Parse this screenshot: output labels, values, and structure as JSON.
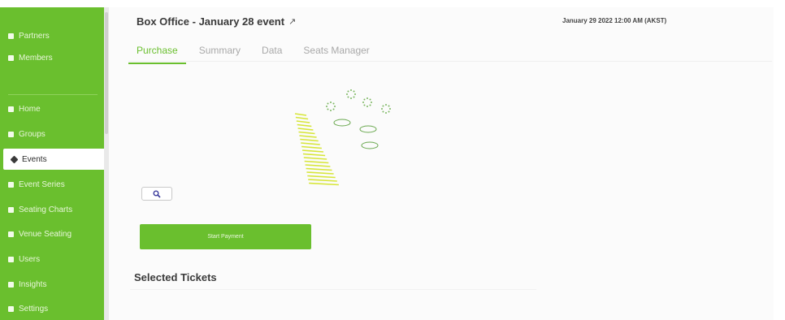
{
  "header": {
    "title": "Box Office - January 28 event",
    "datetime": "January 29 2022 12:00 AM (AKST)"
  },
  "tabs": [
    {
      "label": "Purchase",
      "active": true
    },
    {
      "label": "Summary",
      "active": false
    },
    {
      "label": "Data",
      "active": false
    },
    {
      "label": "Seats Manager",
      "active": false
    }
  ],
  "sidebar": {
    "items": [
      {
        "label": "Partners",
        "icon": "partners-icon"
      },
      {
        "label": "Members",
        "icon": "members-icon"
      },
      {
        "label": "Home",
        "icon": "home-icon"
      },
      {
        "label": "Groups",
        "icon": "groups-icon"
      },
      {
        "label": "Events",
        "icon": "events-icon",
        "active": true
      },
      {
        "label": "Event Series",
        "icon": "event-series-icon"
      },
      {
        "label": "Seating Charts",
        "icon": "seating-charts-icon"
      },
      {
        "label": "Venue Seating",
        "icon": "venue-seating-icon"
      },
      {
        "label": "Users",
        "icon": "users-icon"
      },
      {
        "label": "Insights",
        "icon": "insights-icon"
      },
      {
        "label": "Settings",
        "icon": "settings-icon"
      }
    ]
  },
  "actions": {
    "zoom_icon": "magnifier-icon",
    "start_payment_label": "Start Payment"
  },
  "selected_tickets": {
    "title": "Selected Tickets"
  },
  "colors": {
    "accent": "#6abf2e",
    "seat_section": "#d7e63a",
    "table_section": "#6aa84f"
  }
}
